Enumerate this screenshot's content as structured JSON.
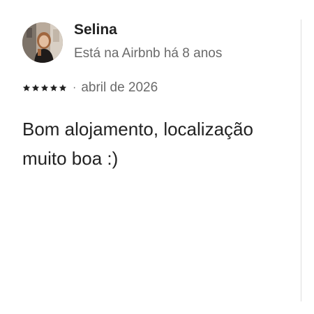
{
  "review": {
    "reviewer_name": "Selina",
    "member_since": "Está na Airbnb há 8 anos",
    "rating_stars": 5,
    "separator": "·",
    "date": "abril de 2026",
    "text": "Bom alojamento, localização muito boa :)",
    "avatar_icon": "reviewer-photo"
  },
  "colors": {
    "primary_text": "#222222",
    "secondary_text": "#6a6a6a",
    "divider": "#dddddd"
  }
}
